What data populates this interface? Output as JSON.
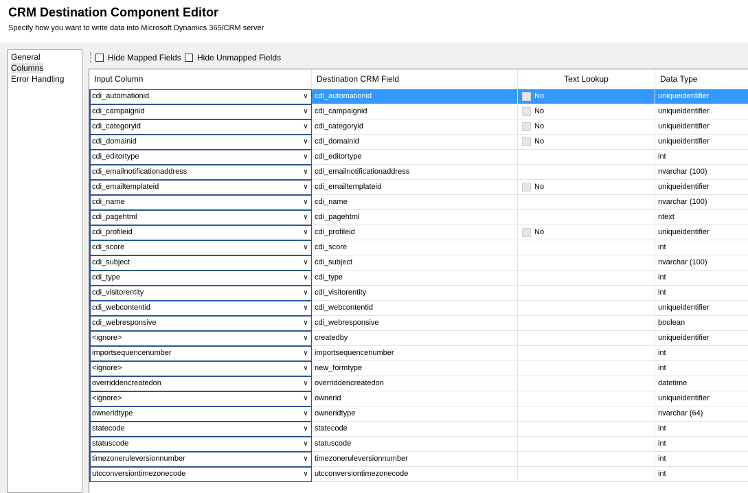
{
  "window": {
    "title": "CRM Destination Component Editor",
    "subtitle": "Specify how you want to write data into Microsoft Dynamics 365/CRM server"
  },
  "nav": {
    "items": [
      {
        "label": "General"
      },
      {
        "label": "Columns",
        "selected": true
      },
      {
        "label": "Error Handling"
      }
    ]
  },
  "toolbar": {
    "hide_mapped_label": "Hide Mapped Fields",
    "hide_mapped_checked": false,
    "hide_unmapped_label": "Hide Unmapped Fields",
    "hide_unmapped_checked": false
  },
  "grid": {
    "headers": {
      "input": "Input Column",
      "dest": "Destination CRM Field",
      "lookup": "Text Lookup",
      "type": "Data Type"
    },
    "selected_row": 0,
    "rows": [
      {
        "input": "cdi_automationid",
        "dest": "cdi_automationid",
        "lookup": "No",
        "type": "uniqueidentifier"
      },
      {
        "input": "cdi_campaignid",
        "dest": "cdi_campaignid",
        "lookup": "No",
        "type": "uniqueidentifier"
      },
      {
        "input": "cdi_categoryid",
        "dest": "cdi_categoryid",
        "lookup": "No",
        "type": "uniqueidentifier"
      },
      {
        "input": "cdi_domainid",
        "dest": "cdi_domainid",
        "lookup": "No",
        "type": "uniqueidentifier"
      },
      {
        "input": "cdi_editortype",
        "dest": "cdi_editortype",
        "lookup": "",
        "type": "int"
      },
      {
        "input": "cdi_emailnotificationaddress",
        "dest": "cdi_emailnotificationaddress",
        "lookup": "",
        "type": "nvarchar (100)"
      },
      {
        "input": "cdi_emailtemplateid",
        "dest": "cdi_emailtemplateid",
        "lookup": "No",
        "type": "uniqueidentifier"
      },
      {
        "input": "cdi_name",
        "dest": "cdi_name",
        "lookup": "",
        "type": "nvarchar (100)"
      },
      {
        "input": "cdi_pagehtml",
        "dest": "cdi_pagehtml",
        "lookup": "",
        "type": "ntext"
      },
      {
        "input": "cdi_profileid",
        "dest": "cdi_profileid",
        "lookup": "No",
        "type": "uniqueidentifier"
      },
      {
        "input": "cdi_score",
        "dest": "cdi_score",
        "lookup": "",
        "type": "int"
      },
      {
        "input": "cdi_subject",
        "dest": "cdi_subject",
        "lookup": "",
        "type": "nvarchar (100)"
      },
      {
        "input": "cdi_type",
        "dest": "cdi_type",
        "lookup": "",
        "type": "int"
      },
      {
        "input": "cdi_visitorentity",
        "dest": "cdi_visitorentity",
        "lookup": "",
        "type": "int"
      },
      {
        "input": "cdi_webcontentid",
        "dest": "cdi_webcontentid",
        "lookup": "",
        "type": "uniqueidentifier"
      },
      {
        "input": "cdi_webresponsive",
        "dest": "cdi_webresponsive",
        "lookup": "",
        "type": "boolean"
      },
      {
        "input": "<ignore>",
        "dest": "createdby",
        "lookup": "",
        "type": "uniqueidentifier"
      },
      {
        "input": "importsequencenumber",
        "dest": "importsequencenumber",
        "lookup": "",
        "type": "int"
      },
      {
        "input": "<ignore>",
        "dest": "new_formtype",
        "lookup": "",
        "type": "int"
      },
      {
        "input": "overriddencreatedon",
        "dest": "overriddencreatedon",
        "lookup": "",
        "type": "datetime"
      },
      {
        "input": "<ignore>",
        "dest": "ownerid",
        "lookup": "",
        "type": "uniqueidentifier"
      },
      {
        "input": "owneridtype",
        "dest": "owneridtype",
        "lookup": "",
        "type": "nvarchar (64)"
      },
      {
        "input": "statecode",
        "dest": "statecode",
        "lookup": "",
        "type": "int"
      },
      {
        "input": "statuscode",
        "dest": "statuscode",
        "lookup": "",
        "type": "int"
      },
      {
        "input": "timezoneruleversionnumber",
        "dest": "timezoneruleversionnumber",
        "lookup": "",
        "type": "int"
      },
      {
        "input": "utcconversiontimezonecode",
        "dest": "utcconversiontimezonecode",
        "lookup": "",
        "type": "int"
      }
    ]
  }
}
